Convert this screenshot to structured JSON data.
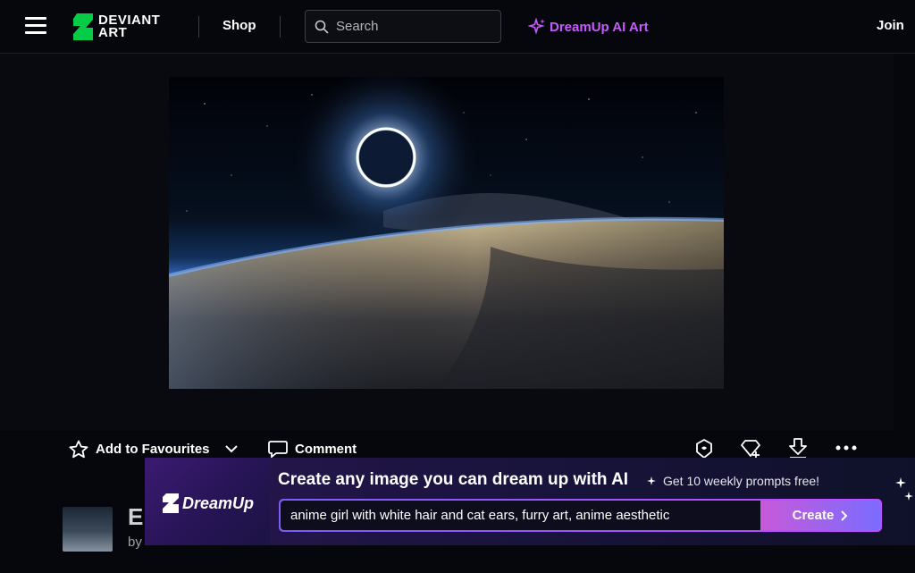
{
  "header": {
    "logo_text_line1": "DEVIANT",
    "logo_text_line2": "ART",
    "shop_label": "Shop",
    "search_placeholder": "Search",
    "dreamup_label": "DreamUp AI Art",
    "join_label": "Join"
  },
  "actions": {
    "favourite_label": "Add to Favourites",
    "comment_label": "Comment"
  },
  "deviation": {
    "title_fragment": "E",
    "by_fragment": "by"
  },
  "banner": {
    "brand": "DreamUp",
    "headline": "Create any image you can dream up with AI",
    "subtext": "Get 10 weekly prompts free!",
    "prompt": "anime girl with white hair and cat ears, furry art, anime aesthetic",
    "create_label": "Create"
  },
  "colors": {
    "brand_green": "#05cc47",
    "dreamup_purple": "#c65cff",
    "background": "#06070d"
  }
}
